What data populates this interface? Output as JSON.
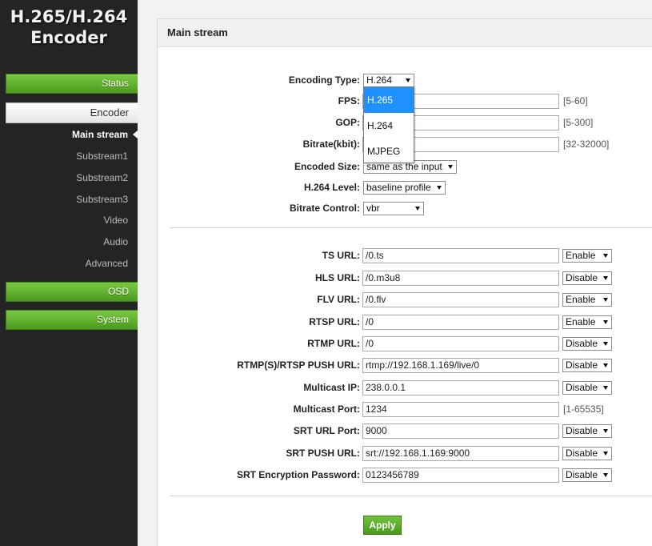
{
  "sidebar": {
    "logo_line1": "H.265/H.264",
    "logo_line2": "Encoder",
    "status": "Status",
    "encoder": "Encoder",
    "sub_items": [
      "Main stream",
      "Substream1",
      "Substream2",
      "Substream3",
      "Video",
      "Audio",
      "Advanced"
    ],
    "osd": "OSD",
    "system": "System"
  },
  "panel": {
    "title": "Main stream"
  },
  "encoding": {
    "encoding_type": {
      "label": "Encoding Type:",
      "value": "H.264",
      "options": [
        "H.265",
        "H.264",
        "MJPEG"
      ],
      "highlighted": "H.265"
    },
    "fps": {
      "label": "FPS:",
      "value": "",
      "hint": "[5-60]"
    },
    "gop": {
      "label": "GOP:",
      "value": "",
      "hint": "[5-300]"
    },
    "bitrate": {
      "label": "Bitrate(kbit):",
      "value": "",
      "hint": "[32-32000]"
    },
    "encoded_size": {
      "label": "Encoded Size:",
      "value": "same as the input"
    },
    "h264_level": {
      "label": "H.264 Level:",
      "value": "baseline profile"
    },
    "bitrate_control": {
      "label": "Bitrate Control:",
      "value": "vbr"
    }
  },
  "urls": [
    {
      "label": "TS URL:",
      "value": "/0.ts",
      "state": "Enable"
    },
    {
      "label": "HLS URL:",
      "value": "/0.m3u8",
      "state": "Disable"
    },
    {
      "label": "FLV URL:",
      "value": "/0.flv",
      "state": "Enable"
    },
    {
      "label": "RTSP URL:",
      "value": "/0",
      "state": "Enable"
    },
    {
      "label": "RTMP URL:",
      "value": "/0",
      "state": "Disable"
    },
    {
      "label": "RTMP(S)/RTSP PUSH URL:",
      "value": "rtmp://192.168.1.169/live/0",
      "state": "Disable"
    },
    {
      "label": "Multicast IP:",
      "value": "238.0.0.1",
      "state": "Disable"
    },
    {
      "label": "Multicast Port:",
      "value": "1234",
      "hint": "[1-65535]"
    },
    {
      "label": "SRT URL Port:",
      "value": "9000",
      "state": "Disable"
    },
    {
      "label": "SRT PUSH URL:",
      "value": "srt://192.168.1.169:9000",
      "state": "Disable"
    },
    {
      "label": "SRT Encryption Password:",
      "value": "0123456789",
      "state": "Disable"
    }
  ],
  "apply_label": "Apply",
  "colors": {
    "sidebar_bg": "#242424",
    "nav_green": "#5cae2e",
    "dropdown_highlight": "#1e90ff"
  }
}
